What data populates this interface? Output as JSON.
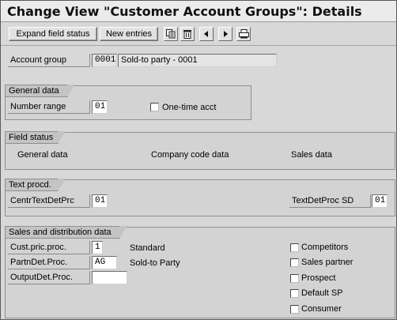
{
  "title": "Change View \"Customer Account Groups\": Details",
  "toolbar": {
    "expand_label": "Expand field status",
    "new_entries_label": "New entries",
    "icons": [
      "copy-icon",
      "delete-icon",
      "previous-icon",
      "next-icon",
      "print-icon"
    ]
  },
  "account_group": {
    "label": "Account group",
    "code": "0001",
    "description": "Sold-to party - 0001"
  },
  "general_data": {
    "tab": "General data",
    "number_range_label": "Number range",
    "number_range_value": "01",
    "one_time_label": "One-time acct",
    "one_time_checked": false
  },
  "field_status": {
    "tab": "Field status",
    "links": [
      "General data",
      "Company code data",
      "Sales data"
    ]
  },
  "text_proc": {
    "tab": "Text procd.",
    "centr_label": "CentrTextDetPrc",
    "centr_value": "01",
    "sd_label": "TextDetProc SD",
    "sd_value": "01"
  },
  "sales": {
    "tab": "Sales and distribution data",
    "cust_pric_label": "Cust.pric.proc.",
    "cust_pric_value": "1",
    "cust_pric_desc": "Standard",
    "partn_label": "PartnDet.Proc.",
    "partn_value": "AG",
    "partn_desc": "Sold-to Party",
    "output_label": "OutputDet.Proc.",
    "output_value": "",
    "checkboxes": [
      {
        "label": "Competitors",
        "checked": false
      },
      {
        "label": "Sales partner",
        "checked": false
      },
      {
        "label": "Prospect",
        "checked": false
      },
      {
        "label": "Default SP",
        "checked": false
      },
      {
        "label": "Consumer",
        "checked": false
      }
    ]
  }
}
